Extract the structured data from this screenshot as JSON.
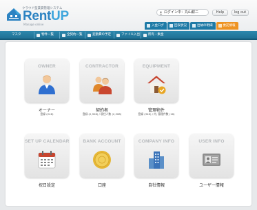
{
  "header": {
    "tagline": "クラウド型賃貸管理システム",
    "brand_prefix": "Rent",
    "brand_suffix": "UP",
    "subbrand": "Manage online",
    "user_label": "ログイン中：丸山耕二",
    "help_label": "Help",
    "logout_label": "log out",
    "top_tabs": [
      {
        "label": "入金ログ",
        "color": "#1e7aa6"
      },
      {
        "label": "回収状況",
        "color": "#1e7aa6"
      },
      {
        "label": "出納の明細",
        "color": "#1e7aa6"
      },
      {
        "label": "委託情報",
        "color": "#ee9322"
      }
    ]
  },
  "nav": {
    "items": [
      {
        "label": "マスタ"
      },
      {
        "label": "物件一覧"
      },
      {
        "label": "全契約一覧"
      },
      {
        "label": "変動費の予定"
      },
      {
        "label": "ファイル入出"
      },
      {
        "label": "所有・集金"
      }
    ]
  },
  "tiles": [
    {
      "title": "OWNER",
      "caption": "オーナー",
      "sub": "登録 (246)",
      "icon": "person-icon"
    },
    {
      "title": "CONTRACTOR",
      "caption": "契約者",
      "sub": "登録 (2,908) / 現住人数 (2,368)",
      "icon": "people-icon"
    },
    {
      "title": "EQUIPMENT",
      "caption": "管理物件",
      "sub": "登録 (346) / 内, 管理件数 (16)",
      "icon": "house-icon"
    },
    {
      "title": "SET UP CALENDAR",
      "caption": "祝日設定",
      "sub": "",
      "icon": "calendar-icon"
    },
    {
      "title": "BANK ACCOUNT",
      "caption": "口座",
      "sub": "",
      "icon": "coin-icon"
    },
    {
      "title": "COMPANY INFO",
      "caption": "自社情報",
      "sub": "",
      "icon": "building-icon"
    },
    {
      "title": "USER INFO",
      "caption": "ユーザー情報",
      "sub": "",
      "icon": "id-card-icon"
    }
  ],
  "colors": {
    "brand": "#2c83c2",
    "nav": "#2080aa",
    "accent_orange": "#ee9322"
  }
}
